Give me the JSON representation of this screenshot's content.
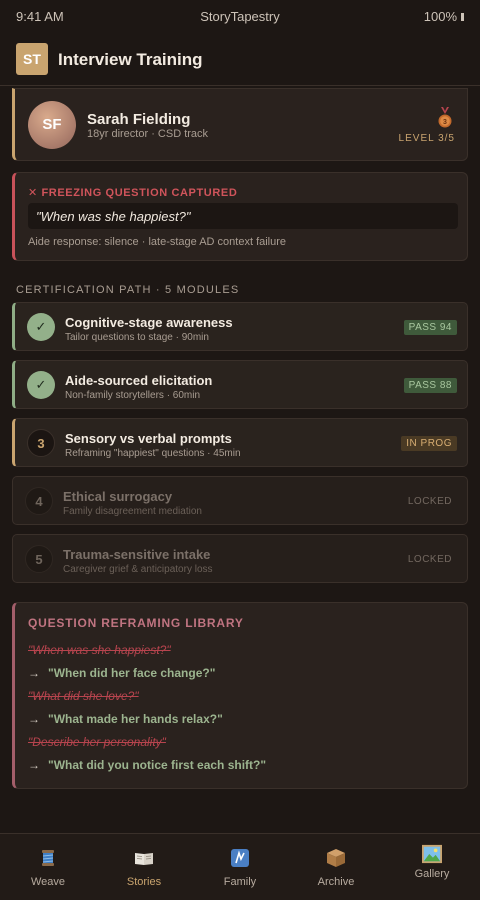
{
  "status_bar": {
    "time": "9:41 AM",
    "app_name": "StoryTapestry",
    "battery": "100%"
  },
  "header": {
    "logo": "ST",
    "title": "Interview Training"
  },
  "profile": {
    "initials": "SF",
    "name": "Sarah Fielding",
    "subtitle": "18yr director · CSD track",
    "medal_icon": "bronze-medal-icon",
    "level": "LEVEL 3/5"
  },
  "freezing": {
    "title": "✕ FREEZING QUESTION CAPTURED",
    "quote": "\"When was she happiest?\"",
    "aide": "Aide response: silence · late-stage AD context failure",
    "accent": "#c8525a"
  },
  "certification": {
    "title": "CERTIFICATION PATH · 5 MODULES",
    "modules": [
      {
        "marker": "✓",
        "title": "Cognitive-stage awareness",
        "subtitle": "Tailor questions to stage · 90min",
        "badge": "PASS 94",
        "state": "done"
      },
      {
        "marker": "✓",
        "title": "Aide-sourced elicitation",
        "subtitle": "Non-family storytellers · 60min",
        "badge": "PASS 88",
        "state": "done"
      },
      {
        "marker": "3",
        "title": "Sensory vs verbal prompts",
        "subtitle": "Reframing \"happiest\" questions · 45min",
        "badge": "IN PROG",
        "state": "in-progress"
      },
      {
        "marker": "4",
        "title": "Ethical surrogacy",
        "subtitle": "Family disagreement mediation",
        "badge": "LOCKED",
        "state": "locked"
      },
      {
        "marker": "5",
        "title": "Trauma-sensitive intake",
        "subtitle": "Caregiver grief & anticipatory loss",
        "badge": "LOCKED",
        "state": "locked"
      }
    ]
  },
  "library": {
    "title": "QUESTION REFRAMING LIBRARY",
    "arrow": "→",
    "pairs": [
      {
        "old": "\"When was she happiest?\"",
        "new": "\"When did her face change?\""
      },
      {
        "old": "\"What did she love?\"",
        "new": "\"What made her hands relax?\""
      },
      {
        "old": "\"Describe her personality\"",
        "new": "\"What did you notice first each shift?\""
      }
    ]
  },
  "tabs": [
    {
      "label": "Weave",
      "icon": "spool-icon"
    },
    {
      "label": "Stories",
      "icon": "open-book-icon",
      "active": true
    },
    {
      "label": "Family",
      "icon": "family-tree-icon"
    },
    {
      "label": "Archive",
      "icon": "box-icon"
    },
    {
      "label": "Gallery",
      "icon": "framed-picture-icon"
    }
  ],
  "colors": {
    "accent_gold": "#c9a46f",
    "pass_green": "#93b08a",
    "alert_red": "#c8525a",
    "library_rose": "#a35e6a"
  }
}
